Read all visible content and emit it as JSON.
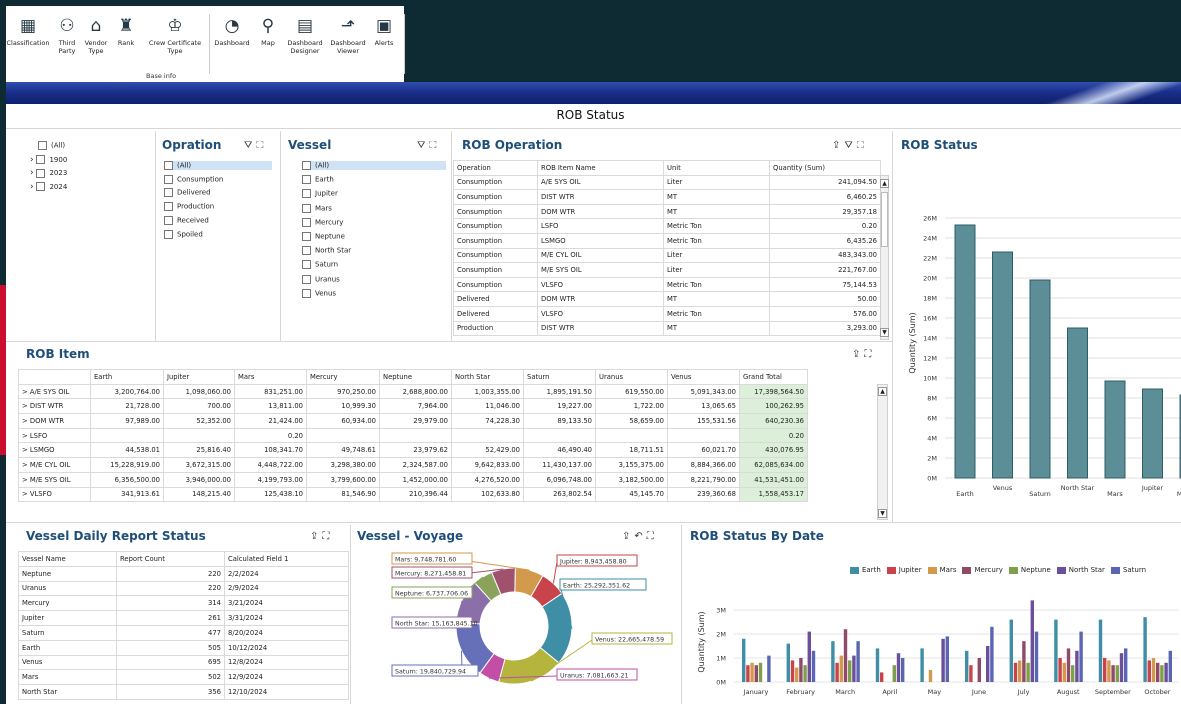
{
  "ribbon": {
    "items": [
      {
        "label": "Classification",
        "icon": "classification-icon",
        "glyph": "▦"
      },
      {
        "label": "Third\nParty",
        "icon": "third-party-icon",
        "glyph": "⚇"
      },
      {
        "label": "Vendor\nType",
        "icon": "vendor-type-icon",
        "glyph": "⌂"
      },
      {
        "label": "Rank",
        "icon": "rank-icon",
        "glyph": "♜"
      },
      {
        "label": "Crew Certificate\nType",
        "icon": "crew-certificate-icon",
        "glyph": "♔"
      },
      {
        "label": "Dashboard",
        "icon": "dashboard-gauge-icon",
        "glyph": "◔"
      },
      {
        "label": "Map",
        "icon": "map-icon",
        "glyph": "⚲"
      },
      {
        "label": "Dashboard\nDesigner",
        "icon": "dashboard-designer-icon",
        "glyph": "▤"
      },
      {
        "label": "Dashboard\nViewer",
        "icon": "dashboard-viewer-icon",
        "glyph": "⬏"
      },
      {
        "label": "Alerts",
        "icon": "alerts-icon",
        "glyph": "▣"
      }
    ],
    "group_label": "Base info"
  },
  "page_title": "ROB Status",
  "year_filter": {
    "items": [
      "(All)",
      "1900",
      "2023",
      "2024"
    ]
  },
  "operation_filter": {
    "title": "Opration",
    "items": [
      "(All)",
      "Consumption",
      "Delivered",
      "Production",
      "Received",
      "Spoiled"
    ]
  },
  "vessel_filter": {
    "title": "Vessel",
    "items": [
      "(All)",
      "Earth",
      "Jupiter",
      "Mars",
      "Mercury",
      "Neptune",
      "North Star",
      "Saturn",
      "Uranus",
      "Venus"
    ]
  },
  "rob_operation": {
    "title": "ROB Operation",
    "columns": [
      "Operation",
      "ROB Item Name",
      "Unit",
      "Quantity (Sum)"
    ],
    "rows": [
      [
        "Consumption",
        "A/E SYS OIL",
        "Liter",
        "241,094.50"
      ],
      [
        "Consumption",
        "DIST WTR",
        "MT",
        "6,460.25"
      ],
      [
        "Consumption",
        "DOM WTR",
        "MT",
        "29,357.18"
      ],
      [
        "Consumption",
        "LSFO",
        "Metric Ton",
        "0.20"
      ],
      [
        "Consumption",
        "LSMGO",
        "Metric Ton",
        "6,435.26"
      ],
      [
        "Consumption",
        "M/E CYL OIL",
        "Liter",
        "483,343.00"
      ],
      [
        "Consumption",
        "M/E SYS OIL",
        "Liter",
        "221,767.00"
      ],
      [
        "Consumption",
        "VLSFO",
        "Metric Ton",
        "75,144.53"
      ],
      [
        "Delivered",
        "DOM WTR",
        "MT",
        "50.00"
      ],
      [
        "Delivered",
        "VLSFO",
        "Metric Ton",
        "576.00"
      ],
      [
        "Production",
        "DIST WTR",
        "MT",
        "3,293.00"
      ]
    ]
  },
  "rob_item": {
    "title": "ROB Item",
    "columns": [
      "",
      "Earth",
      "Jupiter",
      "Mars",
      "Mercury",
      "Neptune",
      "North Star",
      "Saturn",
      "Uranus",
      "Venus",
      "Grand Total"
    ],
    "rows": [
      [
        "A/E SYS OIL",
        "3,200,764.00",
        "1,098,060.00",
        "831,251.00",
        "970,250.00",
        "2,688,800.00",
        "1,003,355.00",
        "1,895,191.50",
        "619,550.00",
        "5,091,343.00",
        "17,398,564.50"
      ],
      [
        "DIST WTR",
        "21,728.00",
        "700.00",
        "13,811.00",
        "10,999.30",
        "7,964.00",
        "11,046.00",
        "19,227.00",
        "1,722.00",
        "13,065.65",
        "100,262.95"
      ],
      [
        "DOM WTR",
        "97,989.00",
        "52,352.00",
        "21,424.00",
        "60,934.00",
        "29,979.00",
        "74,228.30",
        "89,133.50",
        "58,659.00",
        "155,531.56",
        "640,230.36"
      ],
      [
        "LSFO",
        "",
        "",
        "0.20",
        "",
        "",
        "",
        "",
        "",
        "",
        "0.20"
      ],
      [
        "LSMGO",
        "44,538.01",
        "25,816.40",
        "108,341.70",
        "49,748.61",
        "23,979.62",
        "52,429.00",
        "46,490.40",
        "18,711.51",
        "60,021.70",
        "430,076.95"
      ],
      [
        "M/E CYL OIL",
        "15,228,919.00",
        "3,672,315.00",
        "4,448,722.00",
        "3,298,380.00",
        "2,324,587.00",
        "9,642,833.00",
        "11,430,137.00",
        "3,155,375.00",
        "8,884,366.00",
        "62,085,634.00"
      ],
      [
        "M/E SYS OIL",
        "6,356,500.00",
        "3,946,000.00",
        "4,199,793.00",
        "3,799,600.00",
        "1,452,000.00",
        "4,276,520.00",
        "6,096,748.00",
        "3,182,500.00",
        "8,221,790.00",
        "41,531,451.00"
      ],
      [
        "VLSFO",
        "341,913.61",
        "148,215.40",
        "125,438.10",
        "81,546.90",
        "210,396.44",
        "102,633.80",
        "263,802.54",
        "45,145.70",
        "239,360.68",
        "1,558,453.17"
      ]
    ]
  },
  "rob_status": {
    "title": "ROB Status"
  },
  "daily_report": {
    "title": "Vessel Daily Report Status",
    "columns": [
      "Vessel Name",
      "Report Count",
      "Calculated Field 1"
    ],
    "rows": [
      [
        "Neptune",
        "220",
        "2/2/2024"
      ],
      [
        "Uranus",
        "220",
        "2/9/2024"
      ],
      [
        "Mercury",
        "314",
        "3/21/2024"
      ],
      [
        "Jupiter",
        "261",
        "3/31/2024"
      ],
      [
        "Saturn",
        "477",
        "8/20/2024"
      ],
      [
        "Earth",
        "505",
        "10/12/2024"
      ],
      [
        "Venus",
        "695",
        "12/8/2024"
      ],
      [
        "Mars",
        "502",
        "12/9/2024"
      ],
      [
        "North Star",
        "356",
        "12/10/2024"
      ]
    ]
  },
  "voyage": {
    "title": "Vessel - Voyage"
  },
  "by_date": {
    "title": "ROB Status By Date"
  },
  "chart_data": [
    {
      "type": "bar",
      "title": "ROB Status",
      "ylabel": "Quantity (Sum)",
      "ylim": [
        0,
        27000000
      ],
      "y_ticks": [
        "0M",
        "2M",
        "4M",
        "6M",
        "8M",
        "10M",
        "12M",
        "14M",
        "16M",
        "18M",
        "20M",
        "22M",
        "24M",
        "26M"
      ],
      "categories": [
        "Earth",
        "Venus",
        "Saturn",
        "North Star",
        "Mars",
        "Jupiter",
        "Mercury"
      ],
      "values": [
        25300000,
        22600000,
        19800000,
        15000000,
        9700000,
        8900000,
        8300000
      ],
      "color": "#5b8e96"
    },
    {
      "type": "pie",
      "title": "Vessel - Voyage",
      "slices": [
        {
          "label": "Jupiter",
          "value": 8943458.8,
          "color": "#c9434a"
        },
        {
          "label": "Earth",
          "value": 25292351.62,
          "color": "#3e8ea6"
        },
        {
          "label": "Venus",
          "value": 22665478.59,
          "color": "#b5b43c"
        },
        {
          "label": "Uranus",
          "value": 7081663.21,
          "color": "#c24ea6"
        },
        {
          "label": "Saturn",
          "value": 19840729.94,
          "color": "#6670b8"
        },
        {
          "label": "North Star",
          "value": 15163845.1,
          "color": "#8b6fa8"
        },
        {
          "label": "Neptune",
          "value": 6737706.06,
          "color": "#8aa25a"
        },
        {
          "label": "Mercury",
          "value": 8271458.81,
          "color": "#a0516d"
        },
        {
          "label": "Mars",
          "value": 9748781.6,
          "color": "#d39a4c"
        }
      ],
      "slice_labels": [
        "Jupiter: 8,943,458.80",
        "Earth: 25,292,351.62",
        "Venus: 22,665,478.59",
        "Uranus: 7,081,663.21",
        "Saturn: 19,840,729.94",
        "North Star: 15,163,845.10",
        "Neptune: 6,737,706.06",
        "Mercury: 8,271,458.81",
        "Mars: 9,748,781.60"
      ]
    },
    {
      "type": "bar",
      "title": "ROB Status By Date",
      "ylabel": "Quantity (Sum)",
      "ylim": [
        0,
        3500000
      ],
      "y_ticks": [
        "0M",
        "1M",
        "2M",
        "3M"
      ],
      "categories": [
        "January",
        "February",
        "March",
        "April",
        "May",
        "June",
        "July",
        "August",
        "September",
        "October"
      ],
      "series": [
        {
          "name": "Earth",
          "color": "#3e8ea6",
          "values": [
            1800000,
            1600000,
            1700000,
            1400000,
            1400000,
            1300000,
            2600000,
            2600000,
            2600000,
            2700000
          ]
        },
        {
          "name": "Jupiter",
          "color": "#c9434a",
          "values": [
            700000,
            900000,
            800000,
            400000,
            0,
            700000,
            800000,
            1000000,
            1000000,
            900000
          ]
        },
        {
          "name": "Mars",
          "color": "#d39a4c",
          "values": [
            800000,
            600000,
            1100000,
            0,
            500000,
            0,
            900000,
            800000,
            900000,
            1000000
          ]
        },
        {
          "name": "Mercury",
          "color": "#8e4a66",
          "values": [
            700000,
            1000000,
            2200000,
            0,
            0,
            1000000,
            1700000,
            1400000,
            700000,
            800000
          ]
        },
        {
          "name": "Neptune",
          "color": "#7fa04a",
          "values": [
            800000,
            700000,
            900000,
            700000,
            0,
            0,
            800000,
            700000,
            700000,
            700000
          ]
        },
        {
          "name": "North Star",
          "color": "#6b4f9a",
          "values": [
            0,
            2100000,
            1100000,
            1200000,
            1800000,
            1500000,
            3400000,
            1300000,
            1200000,
            800000
          ]
        },
        {
          "name": "Saturn",
          "color": "#5a66b3",
          "values": [
            1100000,
            1300000,
            1700000,
            1000000,
            1900000,
            2300000,
            2100000,
            2100000,
            1400000,
            1300000
          ]
        }
      ]
    }
  ]
}
